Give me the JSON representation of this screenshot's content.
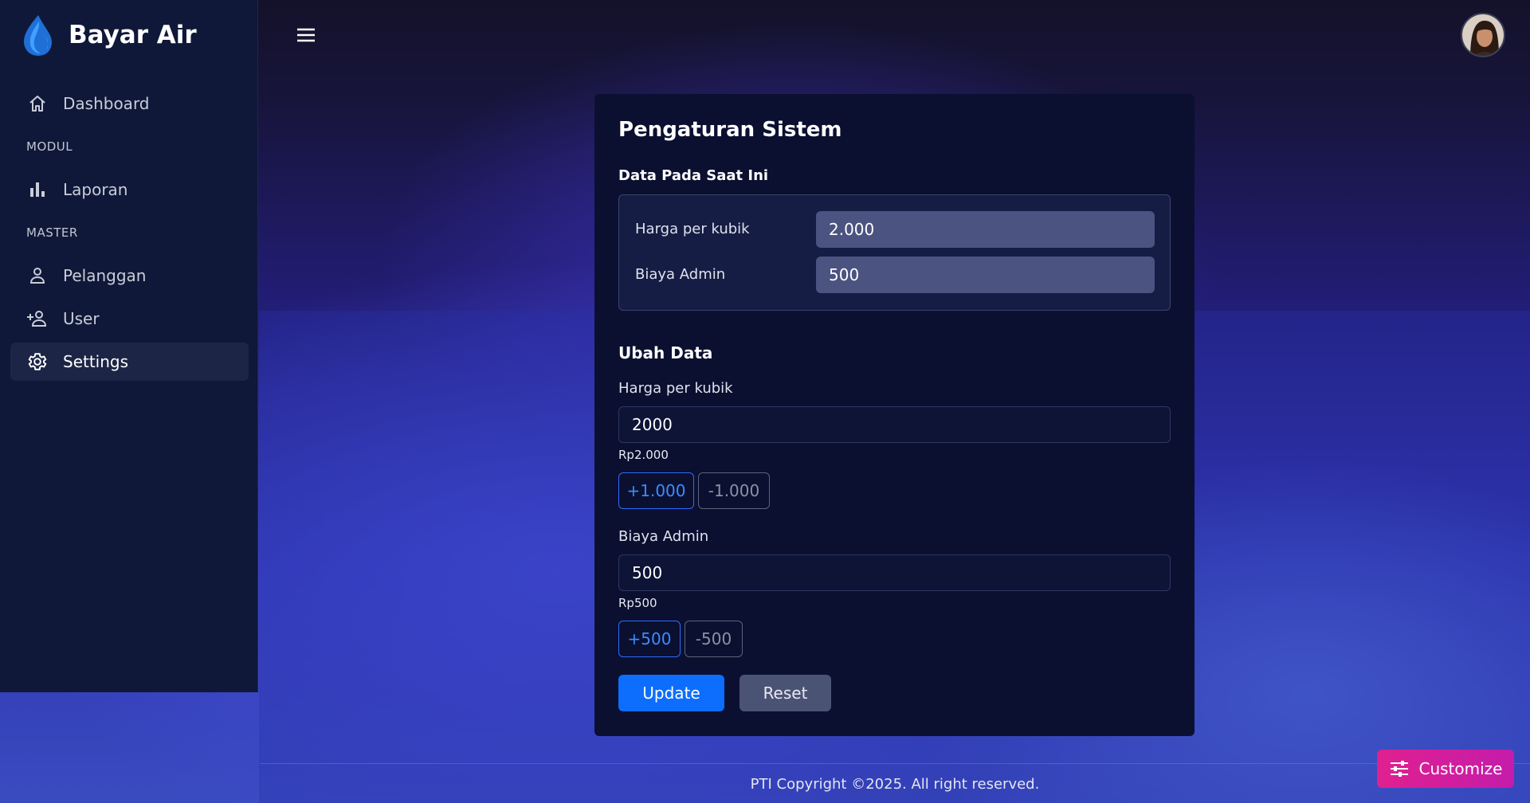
{
  "brand": {
    "title": "Bayar Air",
    "logo_icon": "water-drop-icon"
  },
  "sidebar": {
    "items": [
      {
        "label": "Dashboard",
        "icon": "home-icon"
      },
      {
        "section": "MODUL"
      },
      {
        "label": "Laporan",
        "icon": "bar-chart-icon"
      },
      {
        "section": "MASTER"
      },
      {
        "label": "Pelanggan",
        "icon": "person-icon"
      },
      {
        "label": "User",
        "icon": "person-add-icon"
      },
      {
        "label": "Settings",
        "icon": "gear-icon",
        "active": true
      }
    ]
  },
  "card": {
    "title": "Pengaturan Sistem",
    "current": {
      "heading": "Data Pada Saat Ini",
      "price_label": "Harga per kubik",
      "price_value": "2.000",
      "admin_label": "Biaya Admin",
      "admin_value": "500"
    },
    "edit": {
      "heading": "Ubah Data",
      "price_label": "Harga per kubik",
      "price_value": "2000",
      "price_hint": "Rp2.000",
      "price_plus": "+1.000",
      "price_minus": "-1.000",
      "admin_label": "Biaya Admin",
      "admin_value": "500",
      "admin_hint": "Rp500",
      "admin_plus": "+500",
      "admin_minus": "-500"
    },
    "update_label": "Update",
    "reset_label": "Reset"
  },
  "footer": {
    "text": "PTI Copyright ©2025. All right reserved."
  },
  "customize": {
    "label": "Customize",
    "icon": "sliders-icon"
  },
  "colors": {
    "accent": "#0d6efd",
    "customize": "#e0208f",
    "sidebar": "#0f1838",
    "card": "#0b1031"
  }
}
